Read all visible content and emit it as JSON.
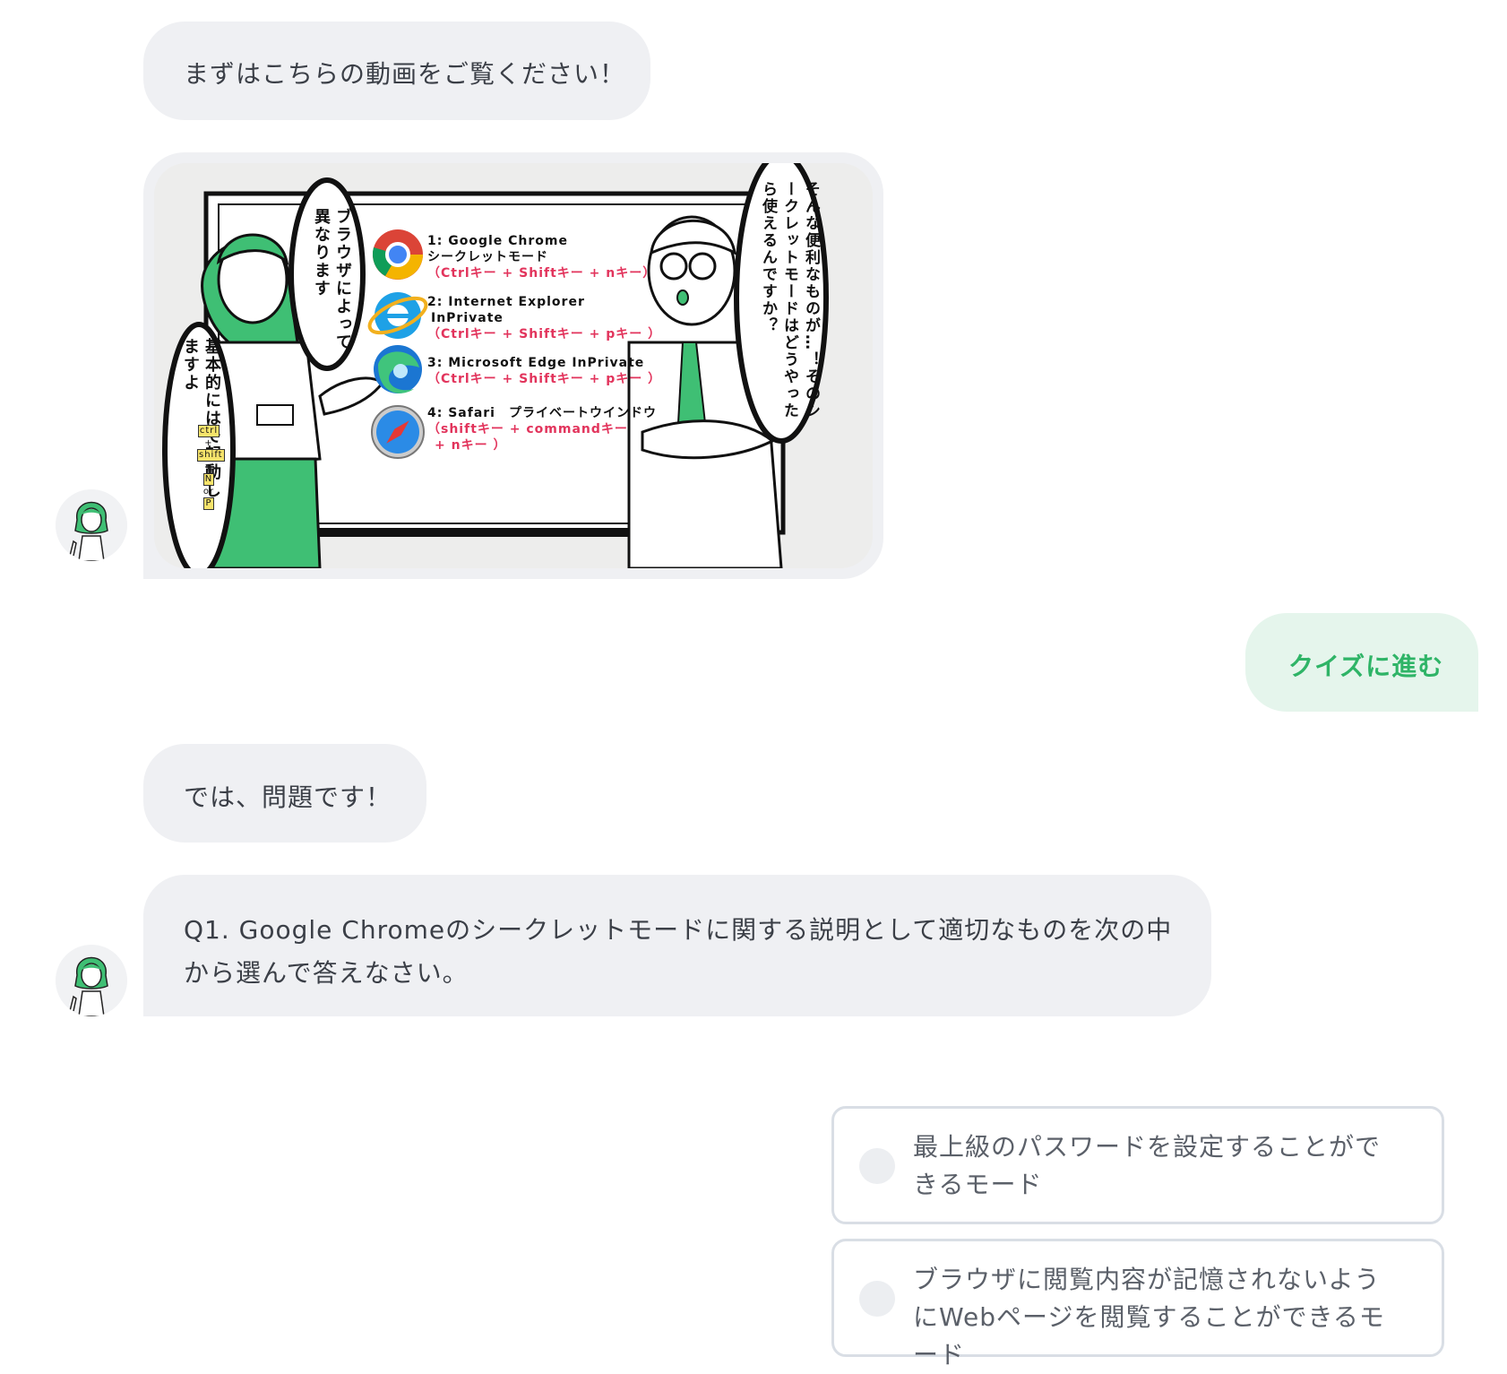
{
  "messages": {
    "intro": "まずはこちらの動画をご覧ください！",
    "lead_in": "では、問題です！",
    "question": "Q1. Google Chromeのシークレットモードに関する説明として適切なものを次の中から選んで答えなさい。"
  },
  "video": {
    "browsers": [
      {
        "title": "1: Google Chrome",
        "subtitle": "シークレットモード",
        "shortcut": "（Ctrlキー + Shiftキー + nキー）",
        "icon": "chrome-icon"
      },
      {
        "title": "2: Internet Explorer",
        "subtitle": "InPrivate",
        "shortcut": "（Ctrlキー + Shiftキー + pキー ）",
        "icon": "internet-explorer-icon"
      },
      {
        "title": "3: Microsoft Edge InPrivate",
        "subtitle": "",
        "shortcut": "（Ctrlキー + Shiftキー + pキー ）",
        "icon": "edge-icon"
      },
      {
        "title": "4: Safari　プライベートウインドウ",
        "subtitle": "",
        "shortcut": "（shiftキー + commandキー",
        "shortcut2": "+ nキー ）",
        "icon": "safari-icon"
      }
    ],
    "speech_center": "ブラウザによって異なります",
    "speech_left": "基本的にはで起動しますよ",
    "speech_right": "そんな便利なものが…！そのシークレットモードはどうやったら使えるんですか？",
    "keys": [
      "ctrl",
      "shift",
      "N",
      "or",
      "P"
    ]
  },
  "user_reply": "クイズに進む",
  "options": [
    "最上級のパスワードを設定することができるモード",
    "ブラウザに閲覧内容が記憶されないようにWebページを閲覧することができるモード"
  ],
  "colors": {
    "accent": "#2fb467",
    "bubble": "#eff0f3",
    "user_bubble": "#e5f5ec",
    "character_green": "#3fbf74"
  }
}
